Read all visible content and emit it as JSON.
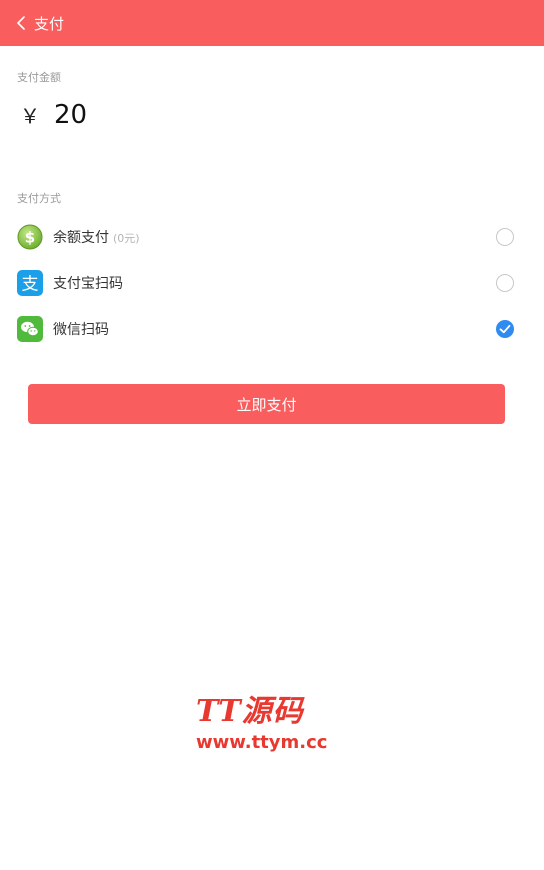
{
  "header": {
    "back_icon": "chevron-left-icon",
    "title": "支付"
  },
  "amount_section": {
    "label": "支付金额",
    "currency": "￥",
    "value": "20"
  },
  "method_section": {
    "label": "支付方式",
    "methods": [
      {
        "icon": "balance-coin-icon",
        "label": "余额支付",
        "sub": "(0元)",
        "checked": false,
        "color": "#8cc63f"
      },
      {
        "icon": "alipay-icon",
        "label": "支付宝扫码",
        "sub": "",
        "checked": false,
        "color": "#1a9fe8"
      },
      {
        "icon": "wechat-icon",
        "label": "微信扫码",
        "sub": "",
        "checked": true,
        "color": "#4fba3b"
      }
    ]
  },
  "pay_button": {
    "label": "立即支付"
  },
  "watermark": {
    "title": "TT源码",
    "url": "www.ttym.cc"
  },
  "colors": {
    "accent": "#f95d5d",
    "check": "#2f8bf0"
  }
}
